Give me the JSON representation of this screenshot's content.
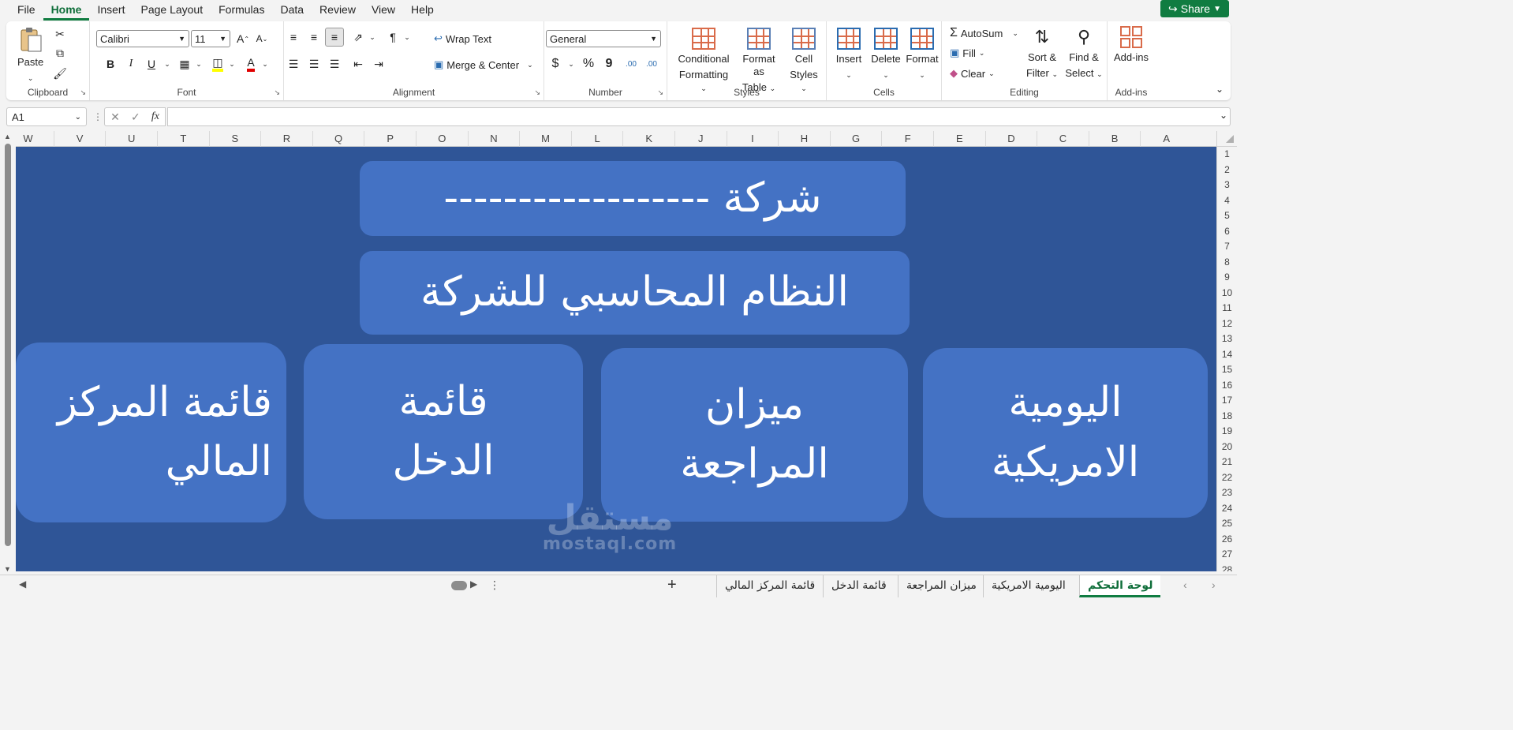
{
  "menu": {
    "items": [
      "File",
      "Home",
      "Insert",
      "Page Layout",
      "Formulas",
      "Data",
      "Review",
      "View",
      "Help"
    ],
    "active": "Home",
    "share_label": "Share"
  },
  "ribbon": {
    "clipboard": {
      "label": "Clipboard",
      "paste": "Paste"
    },
    "font": {
      "label": "Font",
      "name": "Calibri",
      "size": "11",
      "bold": "B",
      "italic": "I",
      "underline": "U",
      "grow": "A",
      "shrink": "A"
    },
    "alignment": {
      "label": "Alignment",
      "wrap_text": "Wrap Text",
      "merge_center": "Merge & Center"
    },
    "number": {
      "label": "Number",
      "format": "General",
      "currency": "$",
      "percent": "%",
      "comma": "9",
      "inc_decimal": ".00",
      "dec_decimal": ".00"
    },
    "styles": {
      "label": "Styles",
      "conditional_1": "Conditional",
      "conditional_2": "Formatting",
      "format_table_1": "Format as",
      "format_table_2": "Table",
      "cell_styles_1": "Cell",
      "cell_styles_2": "Styles"
    },
    "cells": {
      "label": "Cells",
      "insert": "Insert",
      "delete": "Delete",
      "format": "Format"
    },
    "editing": {
      "label": "Editing",
      "autosum": "AutoSum",
      "fill": "Fill",
      "clear": "Clear",
      "sort_1": "Sort &",
      "sort_2": "Filter",
      "find_1": "Find &",
      "find_2": "Select"
    },
    "addins": {
      "label": "Add-ins",
      "addins": "Add-ins"
    }
  },
  "formula_bar": {
    "name_box": "A1",
    "fx": "fx",
    "value": ""
  },
  "columns": [
    "W",
    "V",
    "U",
    "T",
    "S",
    "R",
    "Q",
    "P",
    "O",
    "N",
    "M",
    "L",
    "K",
    "J",
    "I",
    "H",
    "G",
    "F",
    "E",
    "D",
    "C",
    "B",
    "A"
  ],
  "rows": [
    "1",
    "2",
    "3",
    "4",
    "5",
    "6",
    "7",
    "8",
    "9",
    "10",
    "11",
    "12",
    "13",
    "14",
    "15",
    "16",
    "17",
    "18",
    "19",
    "20",
    "21",
    "22",
    "23",
    "24",
    "25",
    "26",
    "27",
    "28"
  ],
  "shapes": {
    "company": "شركة ------------------",
    "system": "النظام المحاسبي للشركة",
    "journal_1": "اليومية",
    "journal_2": "الامريكية",
    "trial_1": "ميزان",
    "trial_2": "المراجعة",
    "income_1": "قائمة",
    "income_2": "الدخل",
    "position_1": "قائمة المركز",
    "position_2": "المالي"
  },
  "watermark": {
    "arabic": "مستقل",
    "latin": "mostaql.com"
  },
  "tabs": {
    "items": [
      "لوحة التحكم",
      "اليومية الامريكية",
      "ميزان المراجعة",
      "قائمة الدخل",
      "قائمة المركز المالي"
    ],
    "active": "لوحة التحكم"
  },
  "colors": {
    "accent": "#107c41",
    "sheet_bg": "#2f5597",
    "shape_bg": "#4472c4"
  }
}
